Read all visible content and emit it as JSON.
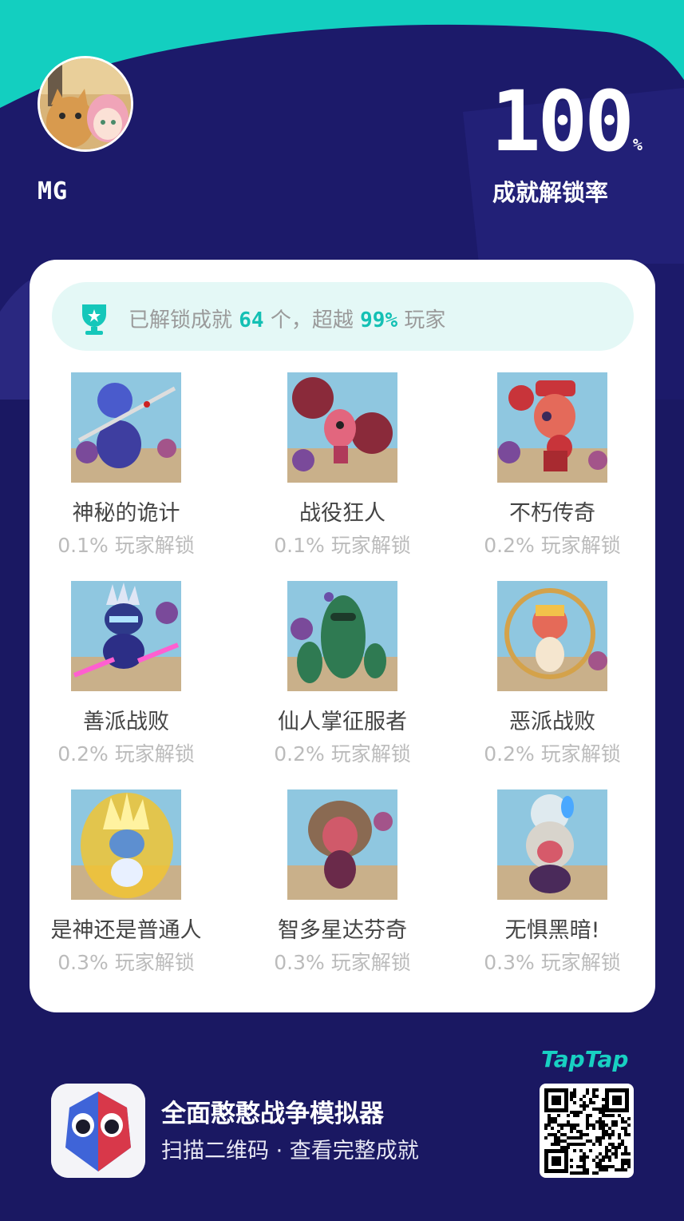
{
  "profile": {
    "username": "MG"
  },
  "unlock_rate": {
    "value": "100",
    "unit": "%",
    "label": "成就解锁率"
  },
  "summary": {
    "prefix": "已解锁成就",
    "count": "64",
    "mid": "个，超越",
    "percent": "99%",
    "suffix": "玩家"
  },
  "achievements": [
    {
      "name": "神秘的诡计",
      "rate": "0.1% 玩家解锁"
    },
    {
      "name": "战役狂人",
      "rate": "0.1% 玩家解锁"
    },
    {
      "name": "不朽传奇",
      "rate": "0.2% 玩家解锁"
    },
    {
      "name": "善派战败",
      "rate": "0.2% 玩家解锁"
    },
    {
      "name": "仙人掌征服者",
      "rate": "0.2% 玩家解锁"
    },
    {
      "name": "恶派战败",
      "rate": "0.2% 玩家解锁"
    },
    {
      "name": "是神还是普通人",
      "rate": "0.3% 玩家解锁"
    },
    {
      "name": "智多星达芬奇",
      "rate": "0.3% 玩家解锁"
    },
    {
      "name": "无惧黑暗!",
      "rate": "0.3% 玩家解锁"
    }
  ],
  "footer": {
    "brand": "TapTap",
    "app_title": "全面憨憨战争模拟器",
    "app_sub": "扫描二维码 · 查看完整成就"
  },
  "colors": {
    "background": "#1a1862",
    "accent": "#14c0b4",
    "card": "#ffffff"
  }
}
